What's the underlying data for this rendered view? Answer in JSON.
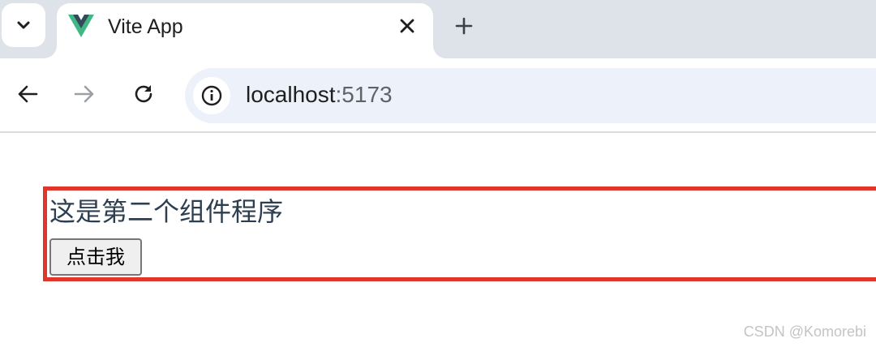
{
  "browser": {
    "tab_search_icon": "chevron-down-icon",
    "tab": {
      "title": "Vite App",
      "favicon": "vue-logo-icon",
      "close_icon": "close-icon"
    },
    "new_tab_icon": "plus-icon",
    "nav": {
      "back_icon": "arrow-left-icon",
      "forward_icon": "arrow-right-icon",
      "reload_icon": "reload-icon"
    },
    "omnibox": {
      "site_info_icon": "info-icon",
      "url_host": "localhost",
      "url_port": ":5173"
    },
    "colors": {
      "tabstrip_bg": "#dee3e9",
      "omnibox_bg": "#edf2fa",
      "vue_green": "#41b883",
      "vue_dark": "#35495e"
    }
  },
  "page": {
    "component_text": "这是第二个组件程序",
    "button_label": "点击我",
    "border_color": "#e0362c"
  },
  "watermark": "CSDN @Komorebi"
}
